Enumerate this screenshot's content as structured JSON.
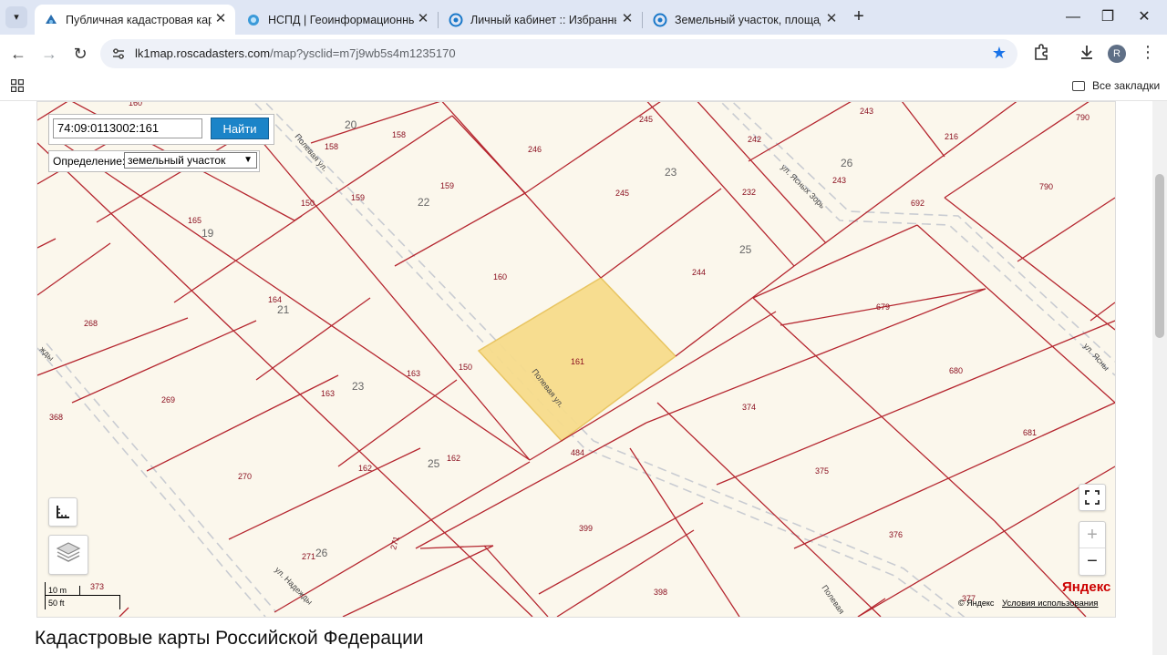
{
  "browser": {
    "tabs": [
      {
        "label": "Публичная кадастровая карта",
        "active": true
      },
      {
        "label": "НСПД | Геоинформационный",
        "active": false
      },
      {
        "label": "Личный кабинет :: Избранные",
        "active": false
      },
      {
        "label": "Земельный участок, площадь",
        "active": false
      }
    ],
    "url_host": "lk1map.roscadasters.com",
    "url_path": "/map?ysclid=m7j9wb5s4m1235170",
    "profile_initial": "R",
    "bookmarks_all": "Все закладки"
  },
  "map": {
    "search_value": "74:09:0113002:161",
    "find_button": "Найти",
    "definition_label": "Определение:",
    "definition_value": "земельный участок",
    "parcel_numbers": [
      "160",
      "245",
      "243",
      "216",
      "790",
      "242",
      "246",
      "158",
      "158",
      "20",
      "150",
      "159",
      "159",
      "22",
      "245",
      "23",
      "232",
      "26",
      "243",
      "692",
      "790",
      "165",
      "19",
      "244",
      "25",
      "268",
      "164",
      "21",
      "160",
      "679",
      "161",
      "150",
      "163",
      "23",
      "163",
      "269",
      "680",
      "368",
      "374",
      "162",
      "25",
      "162",
      "484",
      "681",
      "270",
      "375",
      "271",
      "26",
      "271",
      "399",
      "376",
      "373",
      "398",
      "377"
    ],
    "block_numbers": [
      "20",
      "22",
      "23",
      "26",
      "19",
      "25",
      "21",
      "23",
      "25",
      "26",
      "22"
    ],
    "streets": [
      "Полевая ул.",
      "ул. Ясных Зорь",
      "Полевая ул.",
      "ул. Надежды",
      "ул. Ясны",
      "Полевая",
      "жды"
    ],
    "scale_m": "10 m",
    "scale_ft": "50 ft",
    "zoom_in": "+",
    "zoom_out": "−",
    "yandex_logo": "Яндекс",
    "yandex_copy": "© Яндекс",
    "terms": "Условия использования",
    "highlight_color": "#f7dc8c",
    "boundary_color": "#b5262f"
  },
  "page": {
    "heading": "Кадастровые карты Российской Федерации"
  }
}
